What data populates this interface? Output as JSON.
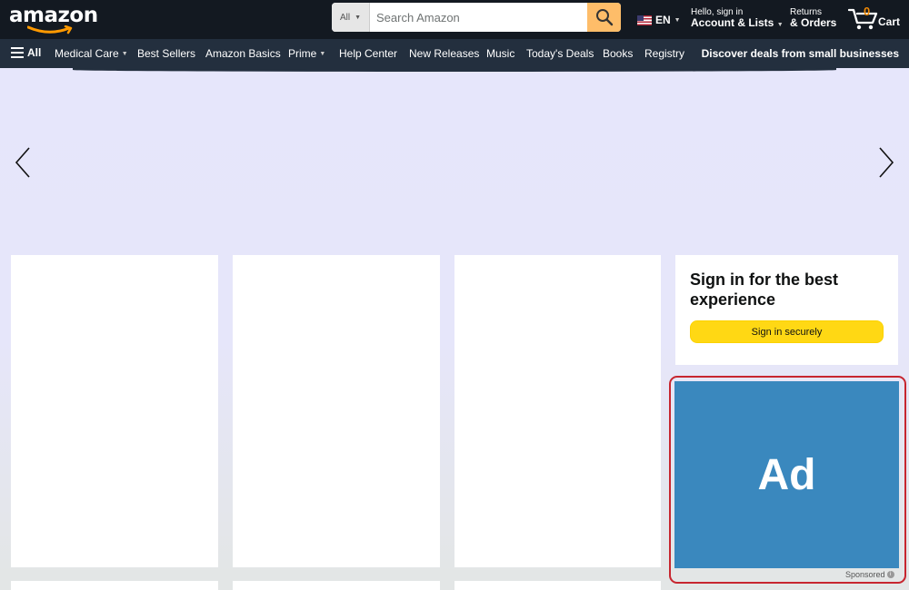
{
  "header": {
    "logo_text": "amazon",
    "search": {
      "category": "All",
      "placeholder": "Search Amazon"
    },
    "language": "EN",
    "account": {
      "line1": "Hello, sign in",
      "line2": "Account & Lists"
    },
    "returns": {
      "line1": "Returns",
      "line2": "& Orders"
    },
    "cart": {
      "count": "0",
      "label": "Cart"
    }
  },
  "subnav": {
    "all_label": "All",
    "items": [
      {
        "label": "Medical Care"
      },
      {
        "label": "Best Sellers"
      },
      {
        "label": "Amazon Basics"
      },
      {
        "label": "Prime"
      },
      {
        "label": "Help Center"
      },
      {
        "label": "New Releases"
      },
      {
        "label": "Music"
      },
      {
        "label": "Today's Deals"
      },
      {
        "label": "Books"
      },
      {
        "label": "Registry"
      }
    ],
    "promo": "Discover deals from small businesses"
  },
  "signin_card": {
    "title": "Sign in for the best experience",
    "button": "Sign in securely"
  },
  "ad": {
    "text": "Ad",
    "sponsored": "Sponsored",
    "color": "#3a88be"
  },
  "colors": {
    "topbar": "#131921",
    "subnav": "#232f3e",
    "search_button": "#febd69",
    "signin_button": "#ffd814",
    "cart_count": "#f08804"
  },
  "icons": {
    "search": "magnifier-icon",
    "cart": "cart-icon",
    "prev": "chevron-left-icon",
    "next": "chevron-right-icon",
    "menu": "hamburger-icon",
    "flag": "us-flag-icon"
  }
}
